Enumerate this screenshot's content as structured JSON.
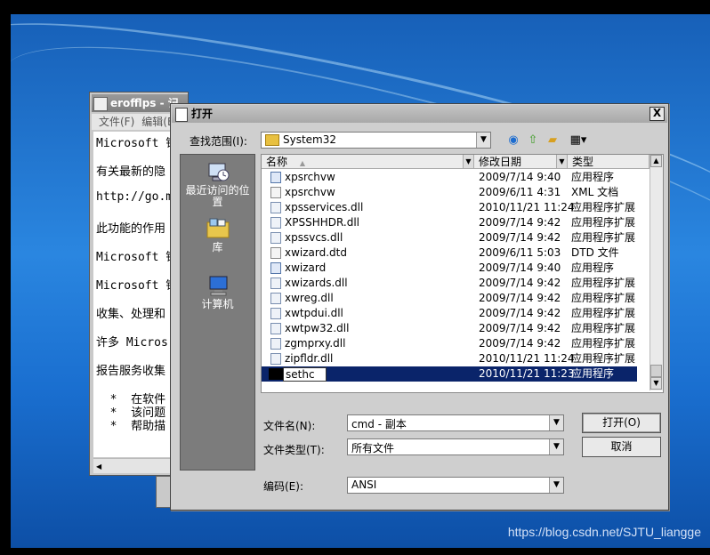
{
  "watermark": "https://blog.csdn.net/SJTU_liangge",
  "notepad": {
    "title": "erofflps - 记事本",
    "menu": [
      "文件(F)",
      "编辑(E)"
    ],
    "lines": [
      "Microsoft 错",
      "有关最新的隐",
      "http://go.m",
      "此功能的作用",
      "Microsoft 错",
      "Microsoft 错",
      "收集、处理和",
      "许多 Micros",
      "报告服务收集",
      "  *  在软件",
      "  *  该问题",
      "  *  帮助描"
    ]
  },
  "dialog": {
    "title": "打开",
    "close": "X",
    "lookin_label": "查找范围(I):",
    "lookin_value": "System32",
    "places": [
      {
        "label": "最近访问的位置",
        "icon": "recent-places-icon"
      },
      {
        "label": "库",
        "icon": "libraries-icon"
      },
      {
        "label": "计算机",
        "icon": "computer-icon"
      }
    ],
    "columns": {
      "name": "名称",
      "date": "修改日期",
      "type": "类型"
    },
    "files": [
      {
        "name": "xpsrchvw",
        "date": "2009/7/14 9:40",
        "type": "应用程序",
        "icon": "app"
      },
      {
        "name": "xpsrchvw",
        "date": "2009/6/11 4:31",
        "type": "XML 文档",
        "icon": "file"
      },
      {
        "name": "xpsservices.dll",
        "date": "2010/11/21 11:24",
        "type": "应用程序扩展",
        "icon": "dll"
      },
      {
        "name": "XPSSHHDR.dll",
        "date": "2009/7/14 9:42",
        "type": "应用程序扩展",
        "icon": "dll"
      },
      {
        "name": "xpssvcs.dll",
        "date": "2009/7/14 9:42",
        "type": "应用程序扩展",
        "icon": "dll"
      },
      {
        "name": "xwizard.dtd",
        "date": "2009/6/11 5:03",
        "type": "DTD 文件",
        "icon": "file"
      },
      {
        "name": "xwizard",
        "date": "2009/7/14 9:40",
        "type": "应用程序",
        "icon": "app"
      },
      {
        "name": "xwizards.dll",
        "date": "2009/7/14 9:42",
        "type": "应用程序扩展",
        "icon": "dll"
      },
      {
        "name": "xwreg.dll",
        "date": "2009/7/14 9:42",
        "type": "应用程序扩展",
        "icon": "dll"
      },
      {
        "name": "xwtpdui.dll",
        "date": "2009/7/14 9:42",
        "type": "应用程序扩展",
        "icon": "dll"
      },
      {
        "name": "xwtpw32.dll",
        "date": "2009/7/14 9:42",
        "type": "应用程序扩展",
        "icon": "dll"
      },
      {
        "name": "zgmprxy.dll",
        "date": "2009/7/14 9:42",
        "type": "应用程序扩展",
        "icon": "dll"
      },
      {
        "name": "zipfldr.dll",
        "date": "2010/11/21 11:24",
        "type": "应用程序扩展",
        "icon": "dll"
      },
      {
        "name": "sethc",
        "date": "2010/11/21 11:23",
        "type": "应用程序",
        "icon": "cmd",
        "selected": true
      }
    ],
    "filename_label": "文件名(N):",
    "filename_value": "cmd - 副本",
    "filetype_label": "文件类型(T):",
    "filetype_value": "所有文件",
    "encoding_label": "编码(E):",
    "encoding_value": "ANSI",
    "open_button": "打开(O)",
    "cancel_button": "取消"
  }
}
